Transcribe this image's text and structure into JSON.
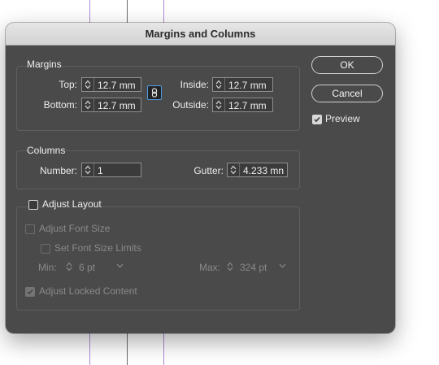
{
  "window": {
    "title": "Margins and Columns"
  },
  "margins": {
    "heading": "Margins",
    "top_label": "Top:",
    "top_value": "12.7 mm",
    "bottom_label": "Bottom:",
    "bottom_value": "12.7 mm",
    "inside_label": "Inside:",
    "inside_value": "12.7 mm",
    "outside_label": "Outside:",
    "outside_value": "12.7 mm"
  },
  "columns": {
    "heading": "Columns",
    "number_label": "Number:",
    "number_value": "1",
    "gutter_label": "Gutter:",
    "gutter_value": "4.233 mn"
  },
  "adjust_layout": {
    "label": "Adjust Layout",
    "checked": false,
    "adjust_font_size_label": "Adjust Font Size",
    "set_font_size_limits_label": "Set Font Size Limits",
    "min_label": "Min:",
    "min_value": "6 pt",
    "max_label": "Max:",
    "max_value": "324 pt",
    "adjust_locked_content_label": "Adjust Locked Content",
    "adjust_locked_content_checked": true
  },
  "buttons": {
    "ok": "OK",
    "cancel": "Cancel"
  },
  "preview": {
    "label": "Preview",
    "checked": true
  },
  "colors": {
    "dialog_bg": "#4a4a4a",
    "titlebar": "#dcdcdc",
    "focus_blue": "#4e9be6",
    "guide_purple": "#b08ad8"
  }
}
